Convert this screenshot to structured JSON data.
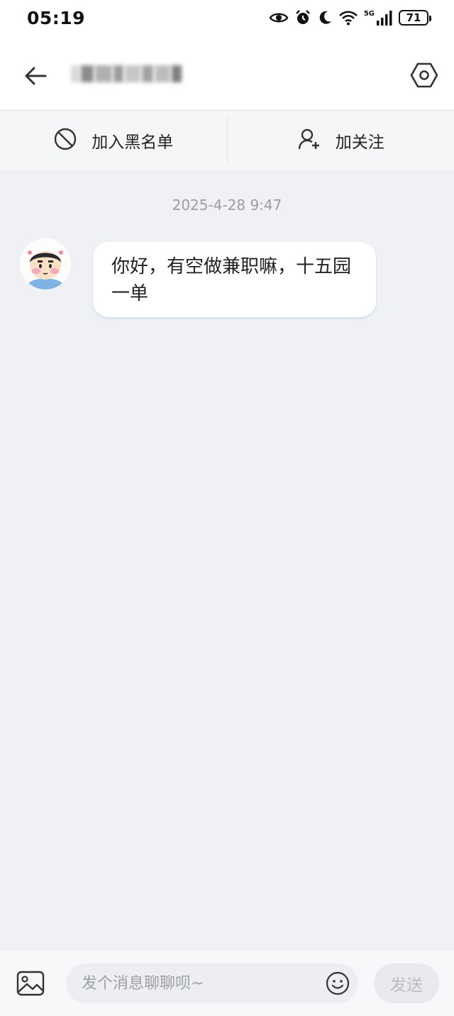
{
  "status_bar": {
    "time": "05:19",
    "network": "5G",
    "battery": "71",
    "icons": [
      "eye-icon",
      "alarm-icon",
      "moon-icon",
      "wifi-icon",
      "signal-icon",
      "battery-icon"
    ]
  },
  "header": {
    "back_icon": "arrow-left-icon",
    "settings_icon": "hexagon-settings-icon"
  },
  "actions": {
    "blacklist_label": "加入黑名单",
    "blacklist_icon": "block-icon",
    "follow_label": "加关注",
    "follow_icon": "user-plus-icon"
  },
  "chat": {
    "timestamp": "2025-4-28 9:47",
    "messages": [
      {
        "sender": "other",
        "text": "你好，有空做兼职嘛，十五园一单"
      }
    ]
  },
  "composer": {
    "placeholder": "发个消息聊聊呗~",
    "send_label": "发送",
    "image_icon": "image-icon",
    "emoji_icon": "emoji-icon"
  },
  "colors": {
    "background": "#eff1f4",
    "bubble": "#ffffff",
    "timestamp": "#9a9da3",
    "send_disabled": "#b9bcc2"
  }
}
